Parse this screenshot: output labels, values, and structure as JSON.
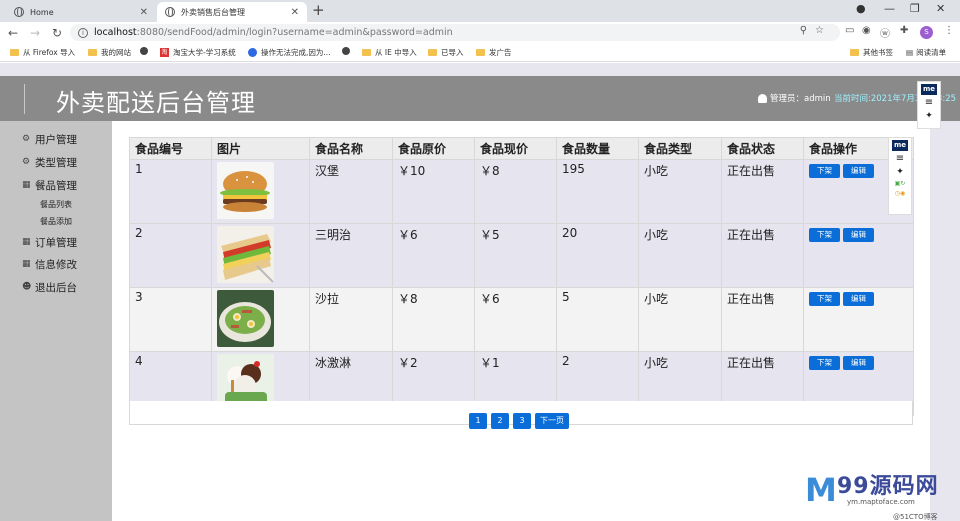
{
  "browser": {
    "tabs": [
      {
        "label": "Home"
      },
      {
        "label": "外卖销售后台管理"
      }
    ],
    "url_host": "localhost",
    "url_path": ":8080/sendFood/admin/login?username=admin&password=admin",
    "bookmarks": [
      "从 Firefox 导入",
      "我的网站",
      "淘宝大学-学习系统",
      "操作无法完成,因为...",
      "从 IE 中导入",
      "已导入",
      "发广告",
      "其他书签",
      "阅读清单"
    ],
    "profile_initial": "S"
  },
  "header": {
    "title": "外卖配送后台管理",
    "user_label": "管理员：admin",
    "time_label": "当前时间:2021年7月3日 13:25"
  },
  "sidebar": {
    "items": [
      {
        "label": "用户管理",
        "icon": "gears-icon"
      },
      {
        "label": "类型管理",
        "icon": "gears-icon"
      },
      {
        "label": "餐品管理",
        "icon": "grid-icon"
      },
      {
        "label": "订单管理",
        "icon": "grid-icon"
      },
      {
        "label": "信息修改",
        "icon": "grid-icon"
      },
      {
        "label": "退出后台",
        "icon": "users-icon"
      }
    ],
    "subitems": [
      "餐品列表",
      "餐品添加"
    ]
  },
  "table": {
    "headers": [
      "食品编号",
      "图片",
      "食品名称",
      "食品原价",
      "食品现价",
      "食品数量",
      "食品类型",
      "食品状态",
      "食品操作"
    ],
    "rows": [
      {
        "id": "1",
        "image": "hamburger",
        "name": "汉堡",
        "orig": "￥10",
        "now": "￥8",
        "qty": "195",
        "type": "小吃",
        "status": "正在出售"
      },
      {
        "id": "2",
        "image": "sandwich",
        "name": "三明治",
        "orig": "￥6",
        "now": "￥5",
        "qty": "20",
        "type": "小吃",
        "status": "正在出售"
      },
      {
        "id": "3",
        "image": "salad",
        "name": "沙拉",
        "orig": "￥8",
        "now": "￥6",
        "qty": "5",
        "type": "小吃",
        "status": "正在出售"
      },
      {
        "id": "4",
        "image": "ice-cream",
        "name": "冰激淋",
        "orig": "￥2",
        "now": "￥1",
        "qty": "2",
        "type": "小吃",
        "status": "正在出售"
      }
    ],
    "action_off": "下架",
    "action_edit": "编辑"
  },
  "pager": {
    "pages": [
      "1",
      "2",
      "3"
    ],
    "next": "下一页"
  },
  "ext_badge": "me",
  "watermark": {
    "big": "99源码网",
    "small": "ym.maptoface.com",
    "copy": "@51CTO博客"
  }
}
